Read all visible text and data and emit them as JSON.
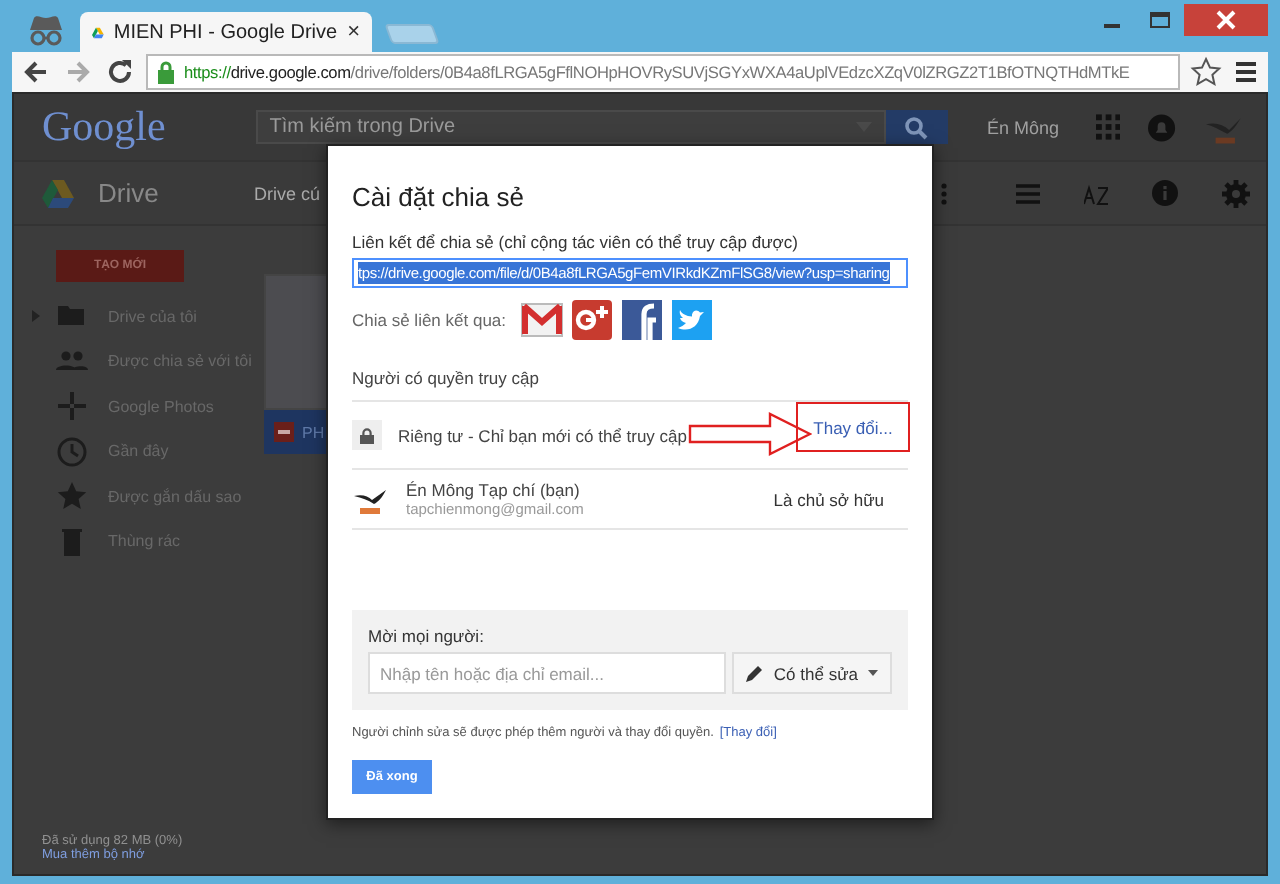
{
  "browser": {
    "tab": {
      "title": "MIEN PHI - Google Drive",
      "close": "×"
    },
    "url": {
      "scheme": "https://",
      "host": "drive.google.com",
      "path": "/drive/folders/0B4a8fLRGA5gFflNOHpHOVRySUVjSGYxWXA4aUplVEdzcXZqV0lZRGZ2T1BfOTNQTHdMTkE"
    }
  },
  "header": {
    "logo": "Google",
    "search": {
      "placeholder": "Tìm kiếm trong Drive"
    },
    "user": "Én Mông"
  },
  "drive_bar": {
    "title": "Drive",
    "location": "Drive cú"
  },
  "sidebar": {
    "new_button": "TẠO MỚI",
    "items": [
      {
        "label": "Drive của tôi",
        "kind": "folder"
      },
      {
        "label": "Được chia sẻ với tôi",
        "kind": "people"
      },
      {
        "label": "Google Photos",
        "kind": "photos"
      },
      {
        "label": "Gần đây",
        "kind": "clock"
      },
      {
        "label": "Được gắn dấu sao",
        "kind": "star"
      },
      {
        "label": "Thùng rác",
        "kind": "trash"
      }
    ],
    "storage": "Đã sử dụng 82 MB (0%)",
    "buy_storage": "Mua thêm bộ nhớ"
  },
  "file": {
    "name": "PH"
  },
  "dialog": {
    "title": "Cài đặt chia sẻ",
    "link_label": "Liên kết để chia sẻ (chỉ cộng tác viên có thể truy cập được)",
    "link": "tps://drive.google.com/file/d/0B4a8fLRGA5gFemVIRkdKZmFlSG8/view?usp=sharing",
    "share_via": "Chia sẻ liên kết qua:",
    "share_targets": [
      {
        "kind": "gmail"
      },
      {
        "kind": "gplus"
      },
      {
        "kind": "facebook"
      },
      {
        "kind": "twitter"
      }
    ],
    "access_title": "Người có quyền truy cập",
    "privacy": {
      "text": "Riêng tư - Chỉ bạn mới có thể truy cập",
      "change": "Thay đổi..."
    },
    "owner": {
      "name": "Én Mông Tạp chí (bạn)",
      "email": "tapchienmong@gmail.com",
      "role": "Là chủ sở hữu"
    },
    "invite": {
      "label": "Mời mọi người:",
      "placeholder": "Nhập tên hoặc địa chỉ email...",
      "permission": "Có thể sửa"
    },
    "note": "Người chỉnh sửa sẽ được phép thêm người và thay đổi quyền.",
    "note_link": "[Thay đổi]",
    "done": "Đã xong"
  }
}
